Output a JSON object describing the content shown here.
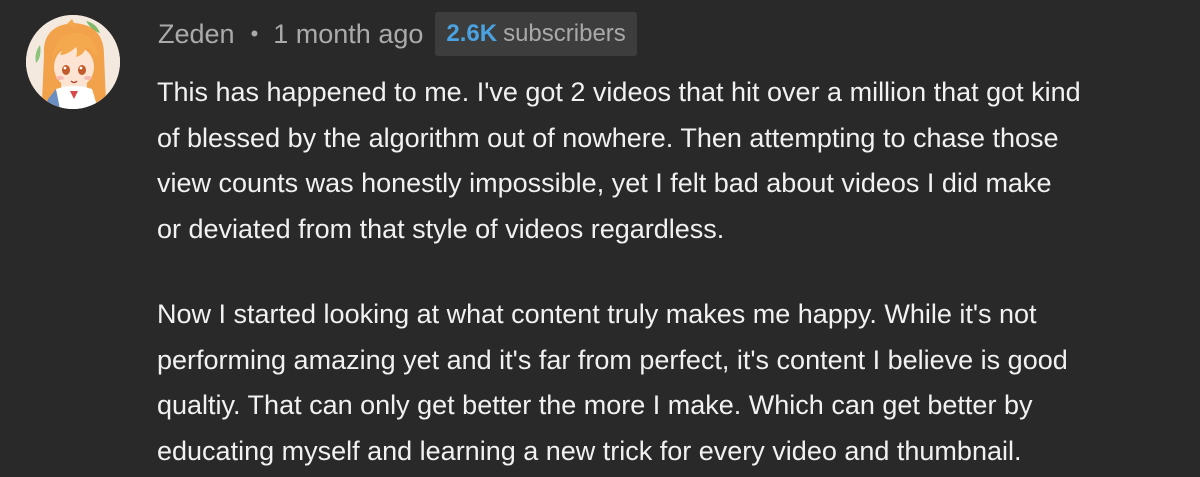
{
  "comment": {
    "avatar_icon": "anime-character-avatar",
    "author": "Zeden",
    "separator": "•",
    "timestamp": "1 month ago",
    "subscriber_badge": {
      "count": "2.6K",
      "label": "subscribers"
    },
    "paragraphs": [
      {
        "lines": [
          "This has happened to me. I've got 2 videos that hit over a million that got kind",
          "of blessed by the algorithm out of nowhere. Then attempting to chase those",
          "view counts was honestly impossible, yet I felt bad about videos I did make",
          "or deviated from that style of videos regardless."
        ]
      },
      {
        "lines": [
          "Now I started looking at what content truly makes me happy. While it's not",
          "performing amazing yet and it's far from perfect,  it's content I believe is good",
          "qualtiy. That can only get better the more I make. Which can get better by",
          "educating myself and learning a new trick for every video and thumbnail."
        ]
      }
    ],
    "colors": {
      "background": "#292929",
      "meta_text": "#aaaaaa",
      "body_text": "#f1f1f1",
      "badge_background": "#3d3d3d",
      "badge_count": "#4aa3e0"
    }
  }
}
